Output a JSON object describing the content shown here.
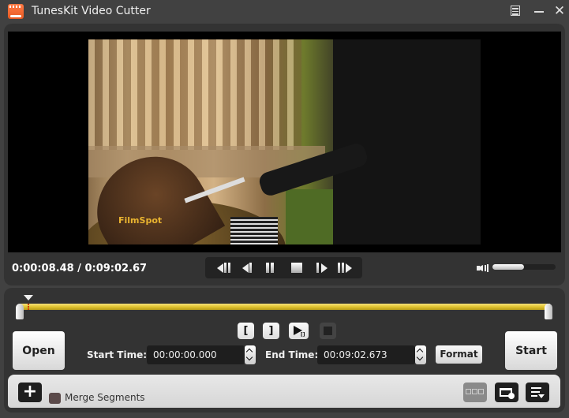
{
  "window": {
    "title": "TunesKit Video Cutter",
    "icons": [
      "app-logo-icon",
      "menu-icon",
      "minimize-icon",
      "close-icon"
    ]
  },
  "player": {
    "current_time": "0:00:08.48",
    "total_time": "0:09:02.67",
    "time_display": "0:00:08.48 / 0:09:02.67",
    "video_watermark": "FilmSpot",
    "transport_controls": [
      "previous-segment",
      "previous-frame",
      "pause",
      "stop",
      "next-frame",
      "next-segment"
    ],
    "volume_percent": 50
  },
  "timeline": {
    "playhead_percent": 1.6,
    "selection_start_percent": 0,
    "selection_end_percent": 100
  },
  "segment_controls": {
    "set_start_label": "[",
    "set_end_label": "]",
    "preview_icon": "play-segment-icon",
    "stop_icon": "stop-icon"
  },
  "edit": {
    "open_label": "Open",
    "start_time_label": "Start Time:",
    "start_time_value": "00:00:00.000",
    "end_time_label": "End Time:",
    "end_time_value": "00:09:02.673",
    "format_label": "Format",
    "start_label": "Start"
  },
  "bottom": {
    "add_label": "+",
    "merge_label": "Merge Segments",
    "merge_checked": false
  },
  "colors": {
    "timeline": "#e2c431",
    "background": "#414141",
    "panel": "#333333"
  }
}
